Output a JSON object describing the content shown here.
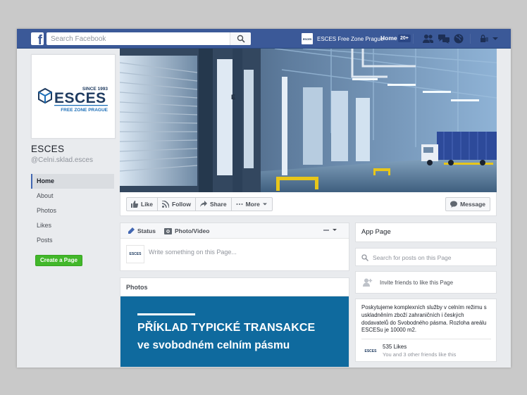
{
  "topbar": {
    "logo_letter": "f",
    "search_placeholder": "Search Facebook",
    "profile_name": "ESCES Free Zone Prague",
    "profile_logo_text": "ESCES",
    "home_label": "Home",
    "home_badge": "20+"
  },
  "page": {
    "name": "ESCES",
    "handle": "@Celni.sklad.esces",
    "logo": {
      "since": "SINCE 1993",
      "brand": "ESCES",
      "tagline": "FREE ZONE PRAGUE"
    }
  },
  "left_nav": [
    {
      "label": "Home",
      "active": true
    },
    {
      "label": "About",
      "active": false
    },
    {
      "label": "Photos",
      "active": false
    },
    {
      "label": "Likes",
      "active": false
    },
    {
      "label": "Posts",
      "active": false
    }
  ],
  "create_page_label": "Create a Page",
  "actions": {
    "like": "Like",
    "follow": "Follow",
    "share": "Share",
    "more": "More",
    "message": "Message"
  },
  "composer": {
    "status_tab": "Status",
    "photo_tab": "Photo/Video",
    "placeholder": "Write something on this Page..."
  },
  "photos": {
    "header": "Photos",
    "banner_line1": "PŘÍKLAD TYPICKÉ TRANSAKCE",
    "banner_line2": "ve svobodném celním pásmu"
  },
  "right": {
    "app_page": "App Page",
    "search_placeholder": "Search for posts on this Page",
    "invite": "Invite friends to like this Page",
    "about_text": "Poskytujeme komplexních služby v celním režimu s uskladněním zboží zahraničních i českých dodavatelů do Svobodného pásma. Rozloha areálu ESCESu je 10000 m2.",
    "likes_count": "535 Likes",
    "likes_sub": "You and 3 other friends like this"
  },
  "colors": {
    "fb_blue": "#3b5998",
    "banner_blue": "#0f6a9e",
    "create_green": "#42b72a",
    "brand_navy": "#1f3b60",
    "brand_blue": "#1d6fb8"
  }
}
